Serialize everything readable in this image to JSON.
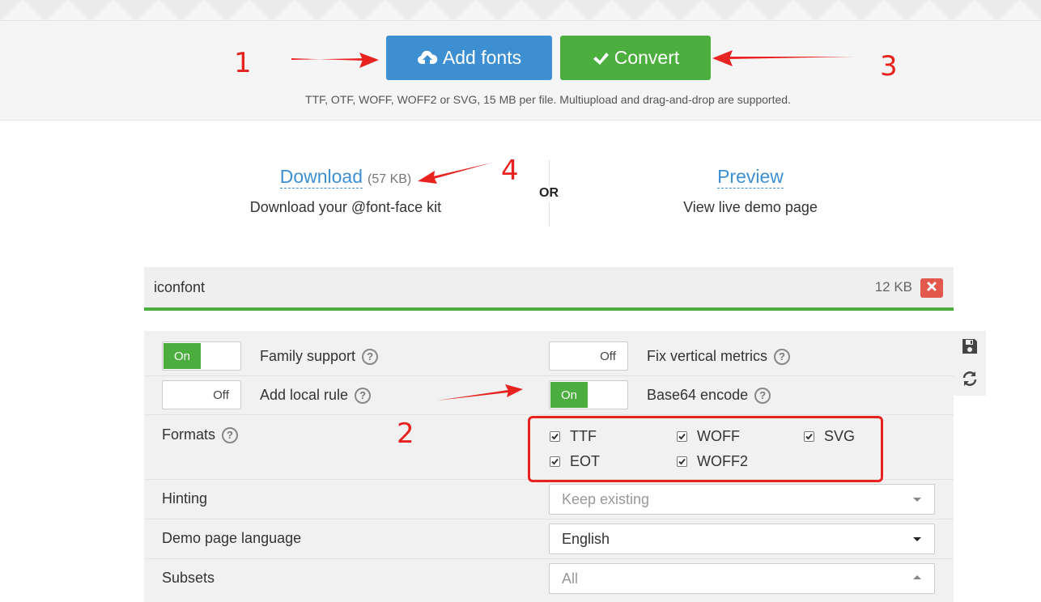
{
  "toolbar": {
    "add_fonts_label": "Add fonts",
    "convert_label": "Convert",
    "upload_note": "TTF, OTF, WOFF, WOFF2 or SVG, 15 MB per file. Multiupload and drag-and-drop are supported."
  },
  "download": {
    "link_label": "Download",
    "size": "(57 KB)",
    "subtitle": "Download your @font-face kit"
  },
  "or_label": "OR",
  "preview": {
    "link_label": "Preview",
    "subtitle": "View live demo page"
  },
  "font_file": {
    "name": "iconfont",
    "size": "12 KB"
  },
  "settings": {
    "family_support": {
      "label": "Family support",
      "state": "On"
    },
    "fix_vertical_metrics": {
      "label": "Fix vertical metrics",
      "state": "Off"
    },
    "add_local_rule": {
      "label": "Add local rule",
      "state": "Off"
    },
    "base64_encode": {
      "label": "Base64 encode",
      "state": "On"
    },
    "formats": {
      "label": "Formats",
      "items": [
        {
          "label": "TTF",
          "checked": true
        },
        {
          "label": "WOFF",
          "checked": true
        },
        {
          "label": "SVG",
          "checked": true
        },
        {
          "label": "EOT",
          "checked": true
        },
        {
          "label": "WOFF2",
          "checked": true
        }
      ]
    },
    "hinting": {
      "label": "Hinting",
      "placeholder": "Keep existing"
    },
    "demo_language": {
      "label": "Demo page language",
      "value": "English"
    },
    "subsets": {
      "label": "Subsets",
      "placeholder": "All"
    }
  },
  "toggle_text": {
    "on": "On",
    "off": "Off"
  },
  "help_glyph": "?",
  "annotations": {
    "n1": "1",
    "n2": "2",
    "n3": "3",
    "n4": "4"
  },
  "colors": {
    "primary_blue": "#3d8fd1",
    "success_green": "#4cae3e",
    "danger_red": "#e2584d",
    "annotation_red": "#e8231f"
  }
}
